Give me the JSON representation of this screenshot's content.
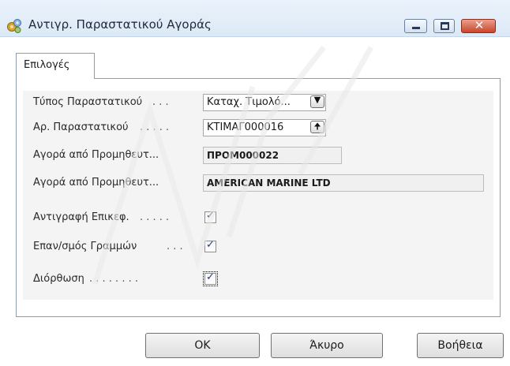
{
  "window": {
    "title": "Αντιγρ. Παραστατικού Αγοράς",
    "icons": {
      "app": "gears-icon",
      "minimize": "minimize-icon",
      "maximize": "maximize-icon",
      "close": "close-icon"
    },
    "close_glyph": "✕"
  },
  "tabs": [
    {
      "label": "Επιλογές",
      "selected": true
    }
  ],
  "form": {
    "doc_type": {
      "label": "Τύπος Παραστατικού",
      "value": "Καταχ. Τιμολό...",
      "icon": "dropdown-arrow-icon",
      "glyph": "▼"
    },
    "doc_number": {
      "label": "Αρ. Παραστατικού",
      "value": "ΚΤΙΜΑΓ000016",
      "icon": "lookup-arrow-icon",
      "glyph": "🠉"
    },
    "vendor_code": {
      "label": "Αγορά από Προμηθευτ...",
      "value": "ΠΡΟΜ000022"
    },
    "vendor_name": {
      "label": "Αγορά από Προμηθευτ...",
      "value": "AMERICAN MARINE LTD"
    },
    "copy_header": {
      "label": "Αντιγραφή Επικεφ.",
      "checked": true
    },
    "recalc_lines": {
      "label": "Επαν/σμός Γραμμών",
      "checked": true
    },
    "correction": {
      "label": "Διόρθωση",
      "checked": true
    }
  },
  "buttons": {
    "ok": "OK",
    "cancel": "Άκυρο",
    "help": "Βοήθεια"
  },
  "colors": {
    "title_bar": "#dce9f6",
    "close_button": "#c9452a",
    "field_bg": "#ffffff",
    "readonly_bg": "#f0f0f0",
    "panel_bg": "#f4f4f4",
    "check_mark": "#1d3f7a"
  }
}
